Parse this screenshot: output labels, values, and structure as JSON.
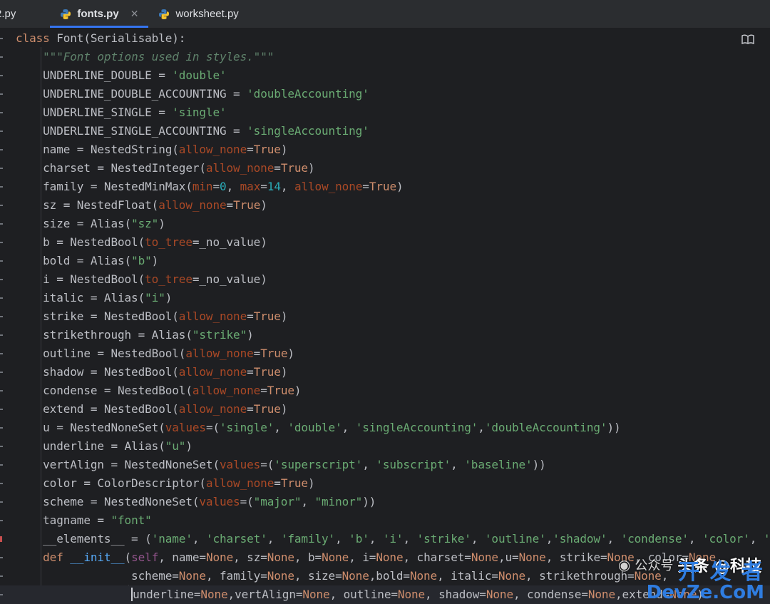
{
  "tabs": [
    {
      "label": "2.py",
      "active": false,
      "closable": false
    },
    {
      "label": "fonts.py",
      "active": true,
      "closable": true
    },
    {
      "label": "worksheet.py",
      "active": false,
      "closable": false
    }
  ],
  "code_lines": [
    [
      [
        "kw",
        "class "
      ],
      [
        "",
        "Font(Serialisable):"
      ]
    ],
    [
      [
        "",
        "    "
      ],
      [
        "doc",
        "\"\"\"Font options used in styles.\"\"\""
      ]
    ],
    [
      [
        "",
        "    UNDERLINE_DOUBLE = "
      ],
      [
        "str",
        "'double'"
      ]
    ],
    [
      [
        "",
        "    UNDERLINE_DOUBLE_ACCOUNTING = "
      ],
      [
        "str",
        "'doubleAccounting'"
      ]
    ],
    [
      [
        "",
        "    UNDERLINE_SINGLE = "
      ],
      [
        "str",
        "'single'"
      ]
    ],
    [
      [
        "",
        "    UNDERLINE_SINGLE_ACCOUNTING = "
      ],
      [
        "str",
        "'singleAccounting'"
      ]
    ],
    [
      [
        "",
        "    name = NestedString("
      ],
      [
        "param",
        "allow_none"
      ],
      [
        "",
        "="
      ],
      [
        "kw",
        "True"
      ],
      [
        "",
        ")"
      ]
    ],
    [
      [
        "",
        "    charset = NestedInteger("
      ],
      [
        "param",
        "allow_none"
      ],
      [
        "",
        "="
      ],
      [
        "kw",
        "True"
      ],
      [
        "",
        ")"
      ]
    ],
    [
      [
        "",
        "    family = NestedMinMax("
      ],
      [
        "param",
        "min"
      ],
      [
        "",
        "="
      ],
      [
        "num",
        "0"
      ],
      [
        "",
        ", "
      ],
      [
        "param",
        "max"
      ],
      [
        "",
        "="
      ],
      [
        "num",
        "14"
      ],
      [
        "",
        ", "
      ],
      [
        "param",
        "allow_none"
      ],
      [
        "",
        "="
      ],
      [
        "kw",
        "True"
      ],
      [
        "",
        ")"
      ]
    ],
    [
      [
        "",
        "    sz = NestedFloat("
      ],
      [
        "param",
        "allow_none"
      ],
      [
        "",
        "="
      ],
      [
        "kw",
        "True"
      ],
      [
        "",
        ")"
      ]
    ],
    [
      [
        "",
        "    size = Alias("
      ],
      [
        "str",
        "\"sz\""
      ],
      [
        "",
        ")"
      ]
    ],
    [
      [
        "",
        "    b = NestedBool("
      ],
      [
        "param",
        "to_tree"
      ],
      [
        "",
        "=_no_value)"
      ]
    ],
    [
      [
        "",
        "    bold = Alias("
      ],
      [
        "str",
        "\"b\""
      ],
      [
        "",
        ")"
      ]
    ],
    [
      [
        "",
        "    i = NestedBool("
      ],
      [
        "param",
        "to_tree"
      ],
      [
        "",
        "=_no_value)"
      ]
    ],
    [
      [
        "",
        "    italic = Alias("
      ],
      [
        "str",
        "\"i\""
      ],
      [
        "",
        ")"
      ]
    ],
    [
      [
        "",
        "    strike = NestedBool("
      ],
      [
        "param",
        "allow_none"
      ],
      [
        "",
        "="
      ],
      [
        "kw",
        "True"
      ],
      [
        "",
        ")"
      ]
    ],
    [
      [
        "",
        "    strikethrough = Alias("
      ],
      [
        "str",
        "\"strike\""
      ],
      [
        "",
        ")"
      ]
    ],
    [
      [
        "",
        "    outline = NestedBool("
      ],
      [
        "param",
        "allow_none"
      ],
      [
        "",
        "="
      ],
      [
        "kw",
        "True"
      ],
      [
        "",
        ")"
      ]
    ],
    [
      [
        "",
        "    shadow = NestedBool("
      ],
      [
        "param",
        "allow_none"
      ],
      [
        "",
        "="
      ],
      [
        "kw",
        "True"
      ],
      [
        "",
        ")"
      ]
    ],
    [
      [
        "",
        "    condense = NestedBool("
      ],
      [
        "param",
        "allow_none"
      ],
      [
        "",
        "="
      ],
      [
        "kw",
        "True"
      ],
      [
        "",
        ")"
      ]
    ],
    [
      [
        "",
        "    extend = NestedBool("
      ],
      [
        "param",
        "allow_none"
      ],
      [
        "",
        "="
      ],
      [
        "kw",
        "True"
      ],
      [
        "",
        ")"
      ]
    ],
    [
      [
        "",
        "    u = NestedNoneSet("
      ],
      [
        "param",
        "values"
      ],
      [
        "",
        "=("
      ],
      [
        "str",
        "'single'"
      ],
      [
        "",
        ", "
      ],
      [
        "str",
        "'double'"
      ],
      [
        "",
        ", "
      ],
      [
        "str",
        "'singleAccounting'"
      ],
      [
        "",
        ","
      ],
      [
        "str",
        "'doubleAccounting'"
      ],
      [
        "",
        "))"
      ]
    ],
    [
      [
        "",
        "    underline = Alias("
      ],
      [
        "str",
        "\"u\""
      ],
      [
        "",
        ")"
      ]
    ],
    [
      [
        "",
        "    vertAlign = NestedNoneSet("
      ],
      [
        "param",
        "values"
      ],
      [
        "",
        "=("
      ],
      [
        "str",
        "'superscript'"
      ],
      [
        "",
        ", "
      ],
      [
        "str",
        "'subscript'"
      ],
      [
        "",
        ", "
      ],
      [
        "str",
        "'baseline'"
      ],
      [
        "",
        "))"
      ]
    ],
    [
      [
        "",
        "    color = ColorDescriptor("
      ],
      [
        "param",
        "allow_none"
      ],
      [
        "",
        "="
      ],
      [
        "kw",
        "True"
      ],
      [
        "",
        ")"
      ]
    ],
    [
      [
        "",
        "    scheme = NestedNoneSet("
      ],
      [
        "param",
        "values"
      ],
      [
        "",
        "=("
      ],
      [
        "str",
        "\"major\""
      ],
      [
        "",
        ", "
      ],
      [
        "str",
        "\"minor\""
      ],
      [
        "",
        "))"
      ]
    ],
    [
      [
        "",
        "    tagname = "
      ],
      [
        "str",
        "\"font\""
      ]
    ],
    [
      [
        "",
        "    __elements__ = ("
      ],
      [
        "str",
        "'name'"
      ],
      [
        "",
        ", "
      ],
      [
        "str",
        "'charset'"
      ],
      [
        "",
        ", "
      ],
      [
        "str",
        "'family'"
      ],
      [
        "",
        ", "
      ],
      [
        "str",
        "'b'"
      ],
      [
        "",
        ", "
      ],
      [
        "str",
        "'i'"
      ],
      [
        "",
        ", "
      ],
      [
        "str",
        "'strike'"
      ],
      [
        "",
        ", "
      ],
      [
        "str",
        "'outline'"
      ],
      [
        "",
        ","
      ],
      [
        "str",
        "'shadow'"
      ],
      [
        "",
        ", "
      ],
      [
        "str",
        "'condense'"
      ],
      [
        "",
        ", "
      ],
      [
        "str",
        "'color'"
      ],
      [
        "",
        ", "
      ],
      [
        "str",
        "'e"
      ]
    ],
    [
      [
        "",
        "    "
      ],
      [
        "kw",
        "def "
      ],
      [
        "func",
        "__init__"
      ],
      [
        "",
        "("
      ],
      [
        "self",
        "self"
      ],
      [
        "",
        ", name="
      ],
      [
        "kw",
        "None"
      ],
      [
        "",
        ", sz="
      ],
      [
        "kw",
        "None"
      ],
      [
        "",
        ", b="
      ],
      [
        "kw",
        "None"
      ],
      [
        "",
        ", i="
      ],
      [
        "kw",
        "None"
      ],
      [
        "",
        ", charset="
      ],
      [
        "kw",
        "None"
      ],
      [
        "",
        ",u="
      ],
      [
        "kw",
        "None"
      ],
      [
        "",
        ", strike="
      ],
      [
        "kw",
        "None"
      ],
      [
        "",
        ", color="
      ],
      [
        "kw",
        "None"
      ],
      [
        "",
        ","
      ]
    ],
    [
      [
        "",
        "                 scheme="
      ],
      [
        "kw",
        "None"
      ],
      [
        "",
        ", family="
      ],
      [
        "kw",
        "None"
      ],
      [
        "",
        ", size="
      ],
      [
        "kw",
        "None"
      ],
      [
        "",
        ",bold="
      ],
      [
        "kw",
        "None"
      ],
      [
        "",
        ", italic="
      ],
      [
        "kw",
        "None"
      ],
      [
        "",
        ", strikethrough="
      ],
      [
        "kw",
        "None"
      ],
      [
        "",
        ","
      ]
    ],
    [
      [
        "",
        "                 underline="
      ],
      [
        "kw",
        "None"
      ],
      [
        "",
        ",vertAlign="
      ],
      [
        "kw",
        "None"
      ],
      [
        "",
        ", outline="
      ],
      [
        "kw",
        "None"
      ],
      [
        "",
        ", shadow="
      ],
      [
        "kw",
        "None"
      ],
      [
        "",
        ", condense="
      ],
      [
        "kw",
        "None"
      ],
      [
        "",
        ",extend="
      ],
      [
        "kw",
        "None"
      ],
      [
        "",
        "):"
      ]
    ]
  ],
  "watermark": {
    "toutiao": "头条 @科技",
    "wechat": "公众号",
    "devze_top": "开 发 者",
    "devze_bottom": "DevZe.CoM"
  }
}
